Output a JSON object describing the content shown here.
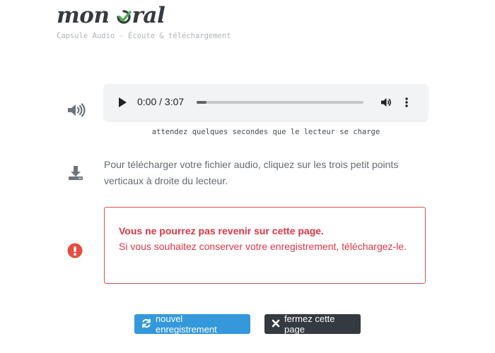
{
  "header": {
    "logo_part1": "mon",
    "logo_part2": "ral",
    "tagline": "Capsule Audio - Écoute & téléchargement"
  },
  "player": {
    "time": "0:00 / 3:07",
    "progress": 0.06,
    "hint": "attendez quelques secondes que le lecteur se charge"
  },
  "download": {
    "text": "Pour télécharger votre fichier audio, cliquez sur les trois petit points verticaux à droite du lecteur."
  },
  "alert": {
    "title": "Vous ne pourrez pas revenir sur cette page.",
    "message": "Si vous souhaitez conserver votre enregistrement, téléchargez-le."
  },
  "buttons": {
    "new_recording": "nouvel enregistrement",
    "close_page": "fermez cette page"
  },
  "colors": {
    "accent_green": "#4caf50",
    "danger": "#dc3545",
    "primary": "#3498db",
    "dark": "#343a40"
  },
  "icons": [
    "volume-icon",
    "download-icon",
    "exclamation-icon",
    "refresh-icon",
    "times-icon"
  ]
}
